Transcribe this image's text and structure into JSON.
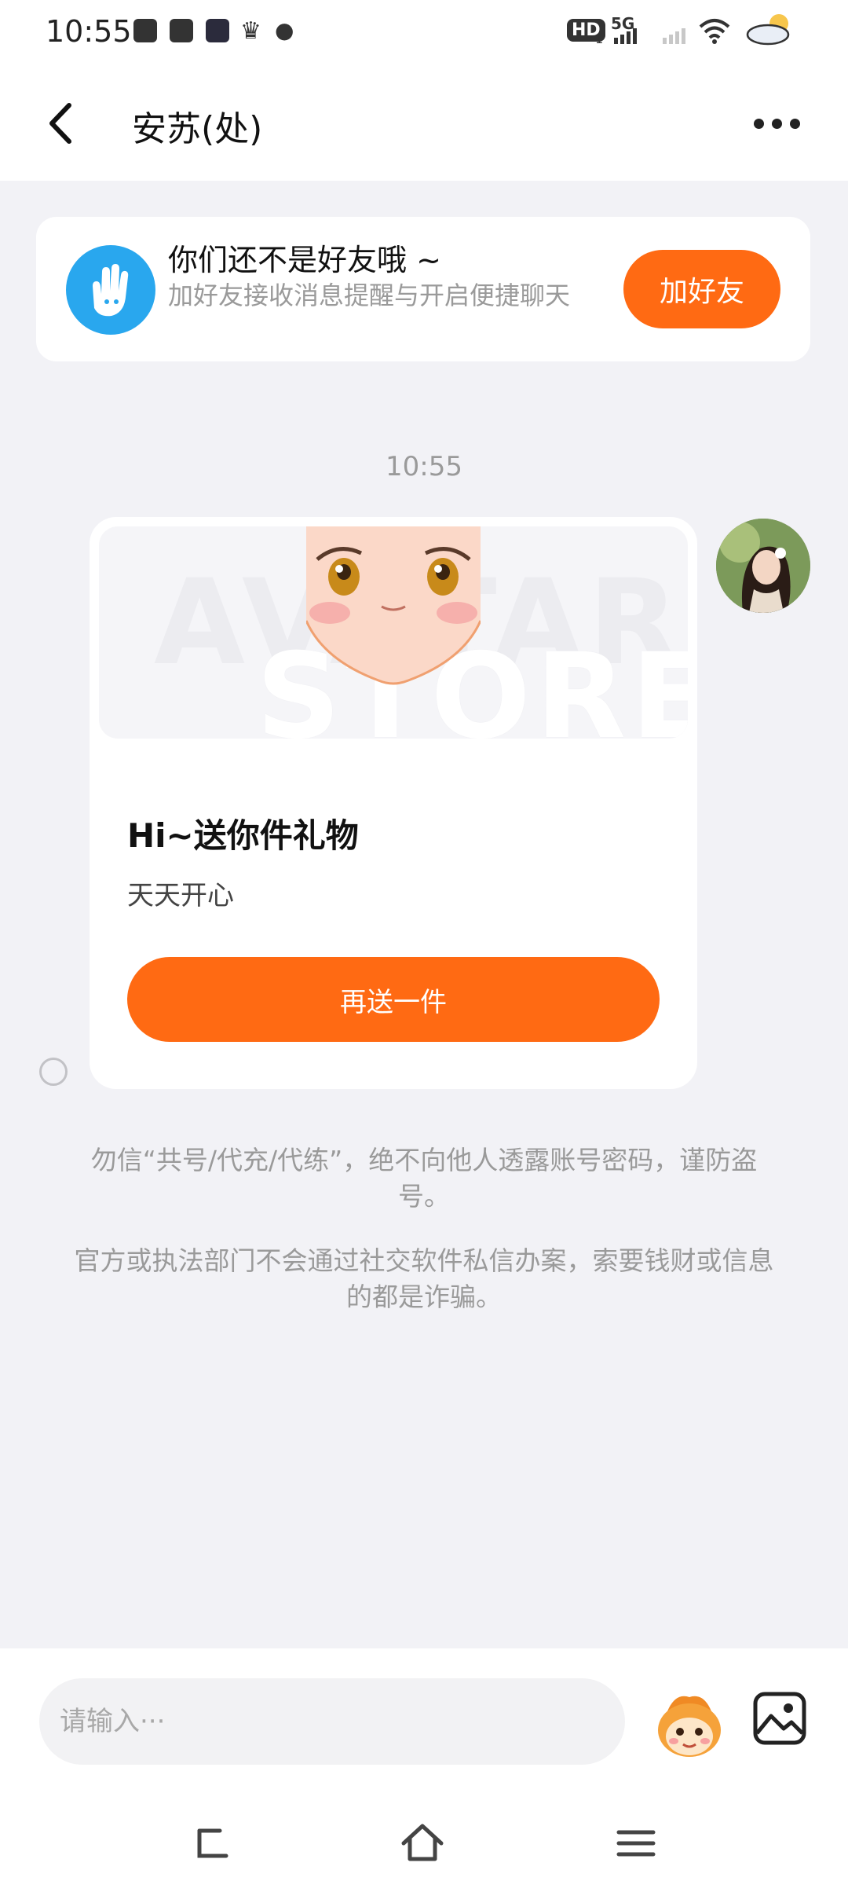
{
  "status_bar": {
    "time": "10:55",
    "hd_label": "HD",
    "hd_sub": "1",
    "network_label": "5G"
  },
  "header": {
    "title": "安苏(处)"
  },
  "friend_banner": {
    "title": "你们还不是好友哦 ~",
    "subtitle": "加好友接收消息提醒与开启便捷聊天",
    "add_button": "加好友"
  },
  "chat": {
    "timestamp": "10:55",
    "gift_card": {
      "watermark_top": "AVATAR",
      "watermark_bottom": "STORE",
      "title": "Hi~送你件礼物",
      "message": "天天开心",
      "resend_button": "再送一件"
    }
  },
  "notices": [
    "勿信“共号/代充/代练”，绝不向他人透露账号密码，谨防盗号。",
    "官方或执法部门不会通过社交软件私信办案，索要钱财或信息的都是诈骗。"
  ],
  "input": {
    "placeholder": "请输入···"
  },
  "colors": {
    "accent": "#ff6a13",
    "banner_icon": "#29a7ee",
    "background": "#f2f2f6"
  },
  "icons": [
    "back-arrow-icon",
    "more-dots-icon",
    "hand-icon",
    "mascot-emoji-icon",
    "gallery-icon",
    "nav-back-icon",
    "nav-home-icon",
    "nav-menu-icon"
  ]
}
